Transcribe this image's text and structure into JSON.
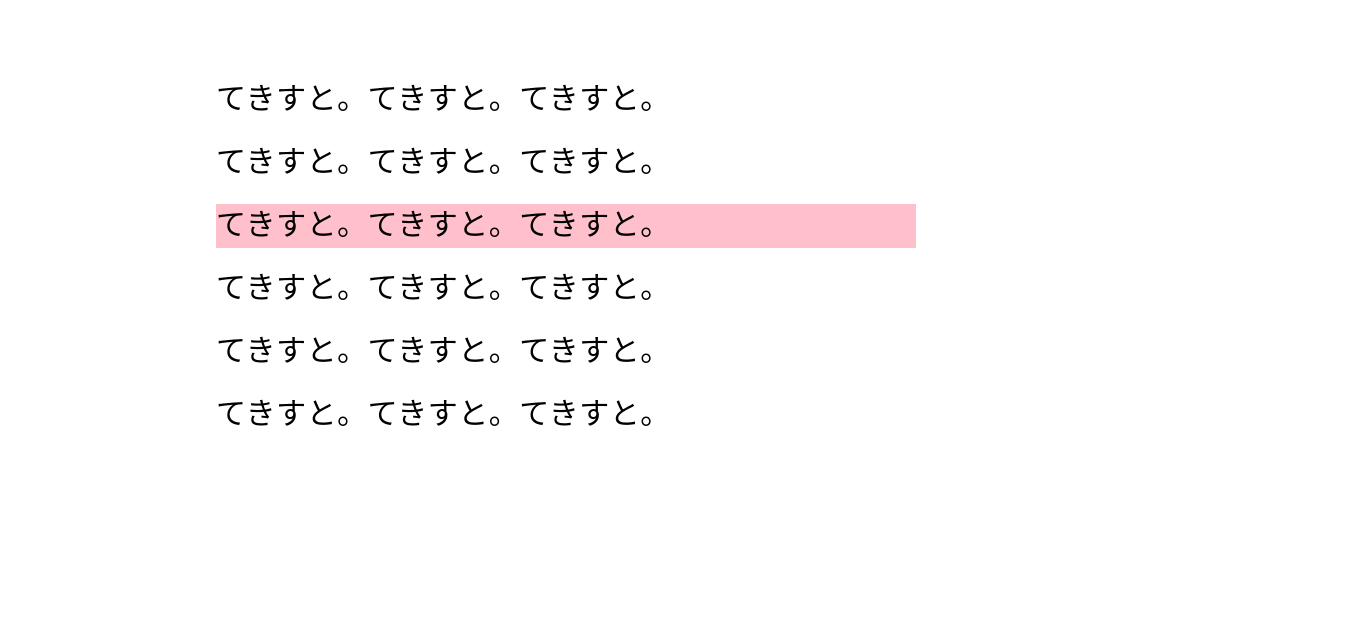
{
  "highlight_color": "#ffc0cb",
  "lines": [
    {
      "text": "てきすと。てきすと。てきすと。",
      "highlighted": false
    },
    {
      "text": "てきすと。てきすと。てきすと。",
      "highlighted": false
    },
    {
      "text": "てきすと。てきすと。てきすと。",
      "highlighted": true
    },
    {
      "text": "てきすと。てきすと。てきすと。",
      "highlighted": false
    },
    {
      "text": "てきすと。てきすと。てきすと。",
      "highlighted": false
    },
    {
      "text": "てきすと。てきすと。てきすと。",
      "highlighted": false
    }
  ]
}
